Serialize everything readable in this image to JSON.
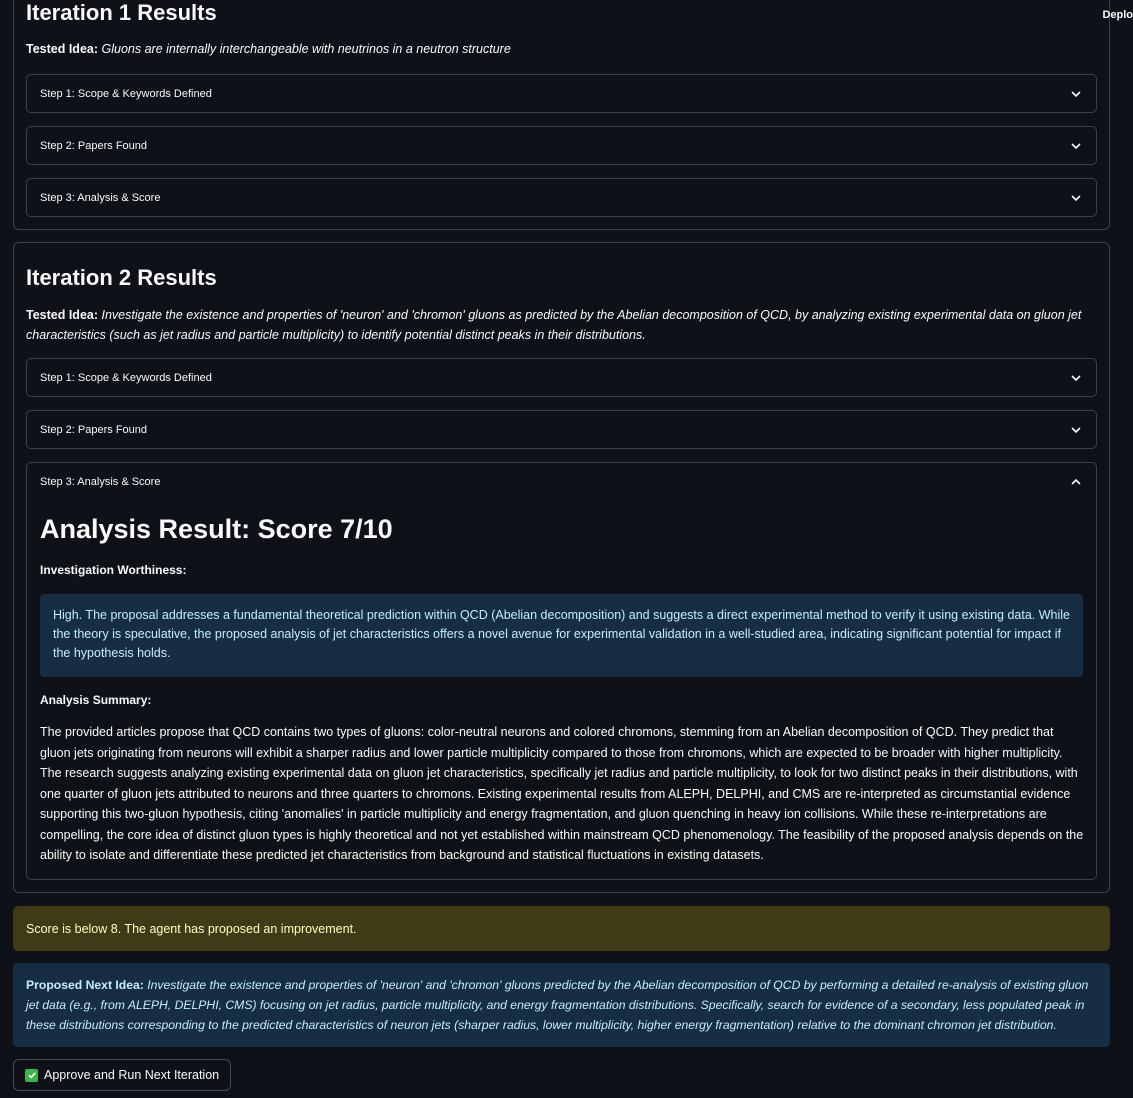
{
  "header": {
    "deploy_label": "Deplo"
  },
  "iterations": [
    {
      "title": "Iteration 1 Results",
      "tested_label": "Tested Idea:",
      "tested_idea": "Gluons are internally interchangeable with neutrinos in a neutron structure",
      "steps": [
        {
          "label": "Step 1: Scope & Keywords Defined",
          "expanded": false
        },
        {
          "label": "Step 2: Papers Found",
          "expanded": false
        },
        {
          "label": "Step 3: Analysis & Score",
          "expanded": false
        }
      ]
    },
    {
      "title": "Iteration 2 Results",
      "tested_label": "Tested Idea:",
      "tested_idea": "Investigate the existence and properties of 'neuron' and 'chromon' gluons as predicted by the Abelian decomposition of QCD, by analyzing existing experimental data on gluon jet characteristics (such as jet radius and particle multiplicity) to identify potential distinct peaks in their distributions.",
      "steps": [
        {
          "label": "Step 1: Scope & Keywords Defined",
          "expanded": false
        },
        {
          "label": "Step 2: Papers Found",
          "expanded": false
        },
        {
          "label": "Step 3: Analysis & Score",
          "expanded": true
        }
      ],
      "analysis": {
        "title": "Analysis Result: Score 7/10",
        "worthiness_label": "Investigation Worthiness:",
        "worthiness_text": "High. The proposal addresses a fundamental theoretical prediction within QCD (Abelian decomposition) and suggests a direct experimental method to verify it using existing data. While the theory is speculative, the proposed analysis of jet characteristics offers a novel avenue for experimental validation in a well-studied area, indicating significant potential for impact if the hypothesis holds.",
        "summary_label": "Analysis Summary:",
        "summary_text": "The provided articles propose that QCD contains two types of gluons: color-neutral neurons and colored chromons, stemming from an Abelian decomposition of QCD. They predict that gluon jets originating from neurons will exhibit a sharper radius and lower particle multiplicity compared to those from chromons, which are expected to be broader with higher multiplicity. The research suggests analyzing existing experimental data on gluon jet characteristics, specifically jet radius and particle multiplicity, to look for two distinct peaks in their distributions, with one quarter of gluon jets attributed to neurons and three quarters to chromons. Existing experimental results from ALEPH, DELPHI, and CMS are re-interpreted as circumstantial evidence supporting this two-gluon hypothesis, citing 'anomalies' in particle multiplicity and energy fragmentation, and gluon quenching in heavy ion collisions. While these re-interpretations are compelling, the core idea of distinct gluon types is highly theoretical and not yet established within mainstream QCD phenomenology. The feasibility of the proposed analysis depends on the ability to isolate and differentiate these predicted jet characteristics from background and statistical fluctuations in existing datasets."
      }
    }
  ],
  "warning": {
    "text": "Score is below 8. The agent has proposed an improvement."
  },
  "next_idea": {
    "label": "Proposed Next Idea:",
    "text": "Investigate the existence and properties of 'neuron' and 'chromon' gluons predicted by the Abelian decomposition of QCD by performing a detailed re-analysis of existing gluon jet data (e.g., from ALEPH, DELPHI, CMS) focusing on jet radius, particle multiplicity, and energy fragmentation distributions. Specifically, search for evidence of a secondary, less populated peak in these distributions corresponding to the predicted characteristics of neuron jets (sharper radius, lower multiplicity, higher energy fragmentation) relative to the dominant chromon jet distribution."
  },
  "approve_button": {
    "label": "Approve and Run Next Iteration"
  },
  "colors": {
    "background": "#0e1117",
    "info_bg": "#172d43",
    "info_text": "#c7ebff",
    "warning_bg": "#3e3b16",
    "warning_text": "#ffffc2",
    "check_green": "#3bb54a"
  }
}
